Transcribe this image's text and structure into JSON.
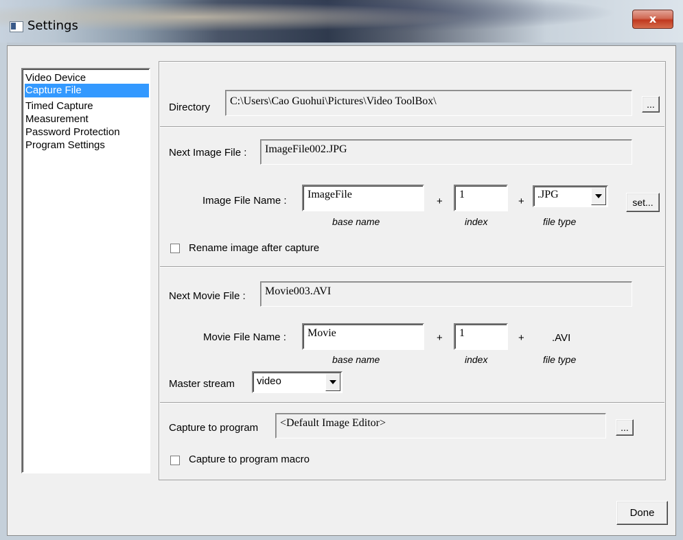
{
  "window": {
    "title": "Settings",
    "close_glyph": "x"
  },
  "colors": {
    "selection": "#3399ff",
    "close_button": "#c7432a",
    "panel_bg": "#f0f0f0"
  },
  "icons": {
    "app": "window-icon",
    "close": "close-icon",
    "dropdown": "chevron-down-icon"
  },
  "nav": {
    "items": [
      {
        "label": "Video Device",
        "selected": false
      },
      {
        "label": "Capture File",
        "selected": true
      },
      {
        "label": "Timed Capture",
        "selected": false
      },
      {
        "label": "Measurement",
        "selected": false
      },
      {
        "label": "Password Protection",
        "selected": false
      },
      {
        "label": "Program Settings",
        "selected": false
      }
    ]
  },
  "directory": {
    "label": "Directory",
    "value": "C:\\Users\\Cao Guohui\\Pictures\\Video ToolBox\\",
    "browse_label": "..."
  },
  "image": {
    "next_label": "Next Image File :",
    "next_value": "ImageFile002.JPG",
    "name_label": "Image File Name :",
    "base_name": "ImageFile",
    "plus": "+",
    "index": "1",
    "file_type": ".JPG",
    "set_label": "set...",
    "hint_base": "base name",
    "hint_index": "index",
    "hint_type": "file type",
    "rename_label": "Rename image after capture",
    "rename_checked": false
  },
  "movie": {
    "next_label": "Next Movie File :",
    "next_value": "Movie003.AVI",
    "name_label": "Movie File Name :",
    "base_name": "Movie",
    "plus": "+",
    "index": "1",
    "file_type": ".AVI",
    "hint_base": "base name",
    "hint_index": "index",
    "hint_type": "file type",
    "master_label": "Master stream",
    "master_value": "video"
  },
  "program": {
    "label": "Capture to program",
    "value": "<Default Image Editor>",
    "browse_label": "...",
    "macro_label": "Capture to program macro",
    "macro_checked": false
  },
  "footer": {
    "done_label": "Done"
  }
}
